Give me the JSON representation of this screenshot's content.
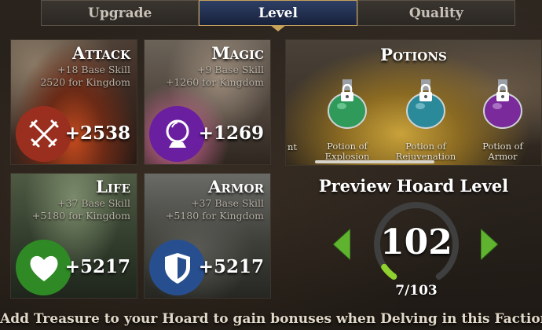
{
  "tabs": [
    {
      "label": "Upgrade",
      "active": false
    },
    {
      "label": "Level",
      "active": true
    },
    {
      "label": "Quality",
      "active": false
    }
  ],
  "cards": {
    "attack": {
      "title": "Attack",
      "base": "+18 Base Skill",
      "kingdom": "2520 for Kingdom",
      "bonus": "+2538",
      "badge_color": "#9b2f1f",
      "icon": "crossed-swords-icon"
    },
    "magic": {
      "title": "Magic",
      "base": "+9 Base Skill",
      "kingdom": "+1260 for Kingdom",
      "bonus": "+1269",
      "badge_color": "#6a1fa0",
      "icon": "crystal-ball-icon"
    },
    "life": {
      "title": "Life",
      "base": "+37 Base Skill",
      "kingdom": "+5180 for Kingdom",
      "bonus": "+5217",
      "badge_color": "#2f8a26",
      "icon": "heart-icon"
    },
    "armor": {
      "title": "Armor",
      "base": "+37 Base Skill",
      "kingdom": "+5180 for Kingdom",
      "bonus": "+5217",
      "badge_color": "#274f8f",
      "icon": "shield-icon"
    }
  },
  "potions": {
    "title": "Potions",
    "cut_label": "nt",
    "items": [
      {
        "line1": "Potion of",
        "line2": "Explosion",
        "color": "#2f9a5a",
        "locked": true
      },
      {
        "line1": "Potion of",
        "line2": "Rejuvenation",
        "color": "#2a8a9a",
        "locked": true
      },
      {
        "line1": "Potion of",
        "line2": "Armor",
        "color": "#7a2a9a",
        "locked": true
      }
    ]
  },
  "preview": {
    "title": "Preview Hoard Level",
    "level": "102",
    "progress_text": "7/103",
    "progress_fraction": 0.068
  },
  "footer": "Add Treasure to your Hoard to gain bonuses when Delving in this Faction!",
  "colors": {
    "accent_gold": "#c8a35a",
    "arrow_green": "#5fb32e",
    "tab_active": "#22304f"
  }
}
